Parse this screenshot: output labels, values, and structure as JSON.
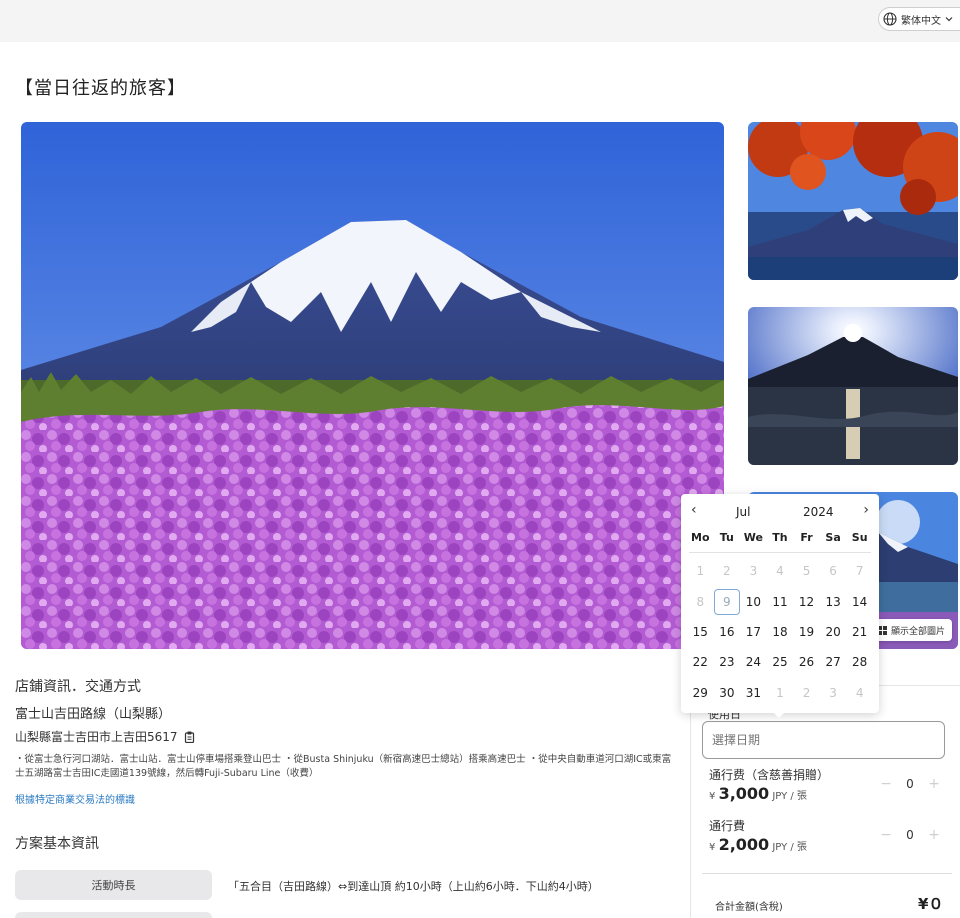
{
  "header": {
    "language_label": "繁体中文"
  },
  "page_title": "【當日往返的旅客】",
  "gallery": {
    "show_all_label": "顯示全部圖片"
  },
  "shop": {
    "section_title": "店鋪資訊．交通方式",
    "name": "富士山吉田路線（山梨縣）",
    "address": "山梨縣富士吉田市上吉田5617",
    "access": "・從富士急行河口湖站．富士山站．富士山停車場搭乘登山巴士 ・從Busta Shinjuku（新宿高速巴士總站）搭乘高速巴士 ・從中央自動車道河口湖IC或東富士五湖路富士吉田IC走國道139號線，然后轉Fuji-Subaru Line（收費）",
    "law_link": "根據特定商業交易法的標識"
  },
  "plan": {
    "section_title": "方案基本資訊",
    "rows": [
      {
        "label": "活動時長",
        "value": "「五合目（吉田路線）⇔到達山頂 約10小時（上山約6小時．下山約4小時）"
      }
    ]
  },
  "booking": {
    "date_label": "使用日",
    "date_placeholder": "選擇日期",
    "tickets": [
      {
        "name": "通行费（含慈善捐贈）",
        "currency": "¥",
        "price": "3,000",
        "unit": "JPY / 張",
        "qty": "0"
      },
      {
        "name": "通行費",
        "currency": "¥",
        "price": "2,000",
        "unit": "JPY / 張",
        "qty": "0"
      }
    ],
    "stepper_minus": "−",
    "stepper_plus": "+",
    "total_label": "合計金額(含稅)",
    "total_value": "¥０"
  },
  "calendar": {
    "month": "Jul",
    "year": "2024",
    "weekdays": [
      "Mo",
      "Tu",
      "We",
      "Th",
      "Fr",
      "Sa",
      "Su"
    ],
    "days": [
      {
        "n": "1",
        "s": "dis"
      },
      {
        "n": "2",
        "s": "dis"
      },
      {
        "n": "3",
        "s": "dis"
      },
      {
        "n": "4",
        "s": "dis"
      },
      {
        "n": "5",
        "s": "dis"
      },
      {
        "n": "6",
        "s": "dis"
      },
      {
        "n": "7",
        "s": "dis"
      },
      {
        "n": "8",
        "s": "dis"
      },
      {
        "n": "9",
        "s": "today"
      },
      {
        "n": "10",
        "s": ""
      },
      {
        "n": "11",
        "s": ""
      },
      {
        "n": "12",
        "s": ""
      },
      {
        "n": "13",
        "s": ""
      },
      {
        "n": "14",
        "s": ""
      },
      {
        "n": "15",
        "s": ""
      },
      {
        "n": "16",
        "s": ""
      },
      {
        "n": "17",
        "s": ""
      },
      {
        "n": "18",
        "s": ""
      },
      {
        "n": "19",
        "s": ""
      },
      {
        "n": "20",
        "s": ""
      },
      {
        "n": "21",
        "s": ""
      },
      {
        "n": "22",
        "s": ""
      },
      {
        "n": "23",
        "s": ""
      },
      {
        "n": "24",
        "s": ""
      },
      {
        "n": "25",
        "s": ""
      },
      {
        "n": "26",
        "s": ""
      },
      {
        "n": "27",
        "s": ""
      },
      {
        "n": "28",
        "s": ""
      },
      {
        "n": "29",
        "s": ""
      },
      {
        "n": "30",
        "s": ""
      },
      {
        "n": "31",
        "s": ""
      },
      {
        "n": "1",
        "s": "dis"
      },
      {
        "n": "2",
        "s": "dis"
      },
      {
        "n": "3",
        "s": "dis"
      },
      {
        "n": "4",
        "s": "dis"
      }
    ]
  }
}
